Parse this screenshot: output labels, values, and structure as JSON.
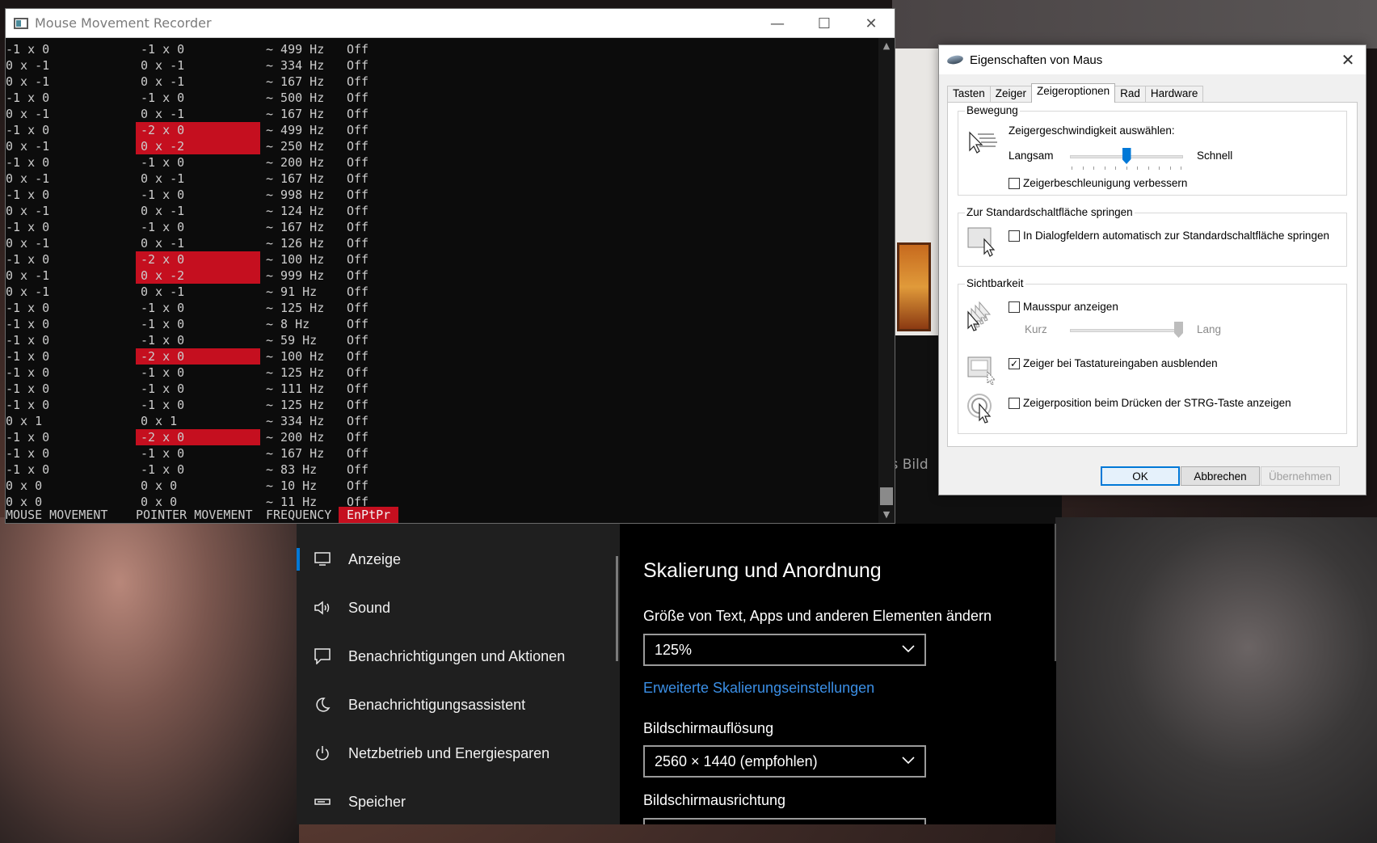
{
  "console": {
    "title": "Mouse Movement Recorder",
    "rows": [
      [
        "-1 x 0",
        "-1 x 0",
        "~ 499 Hz",
        "Off",
        false
      ],
      [
        "0 x -1",
        "0 x -1",
        "~ 334 Hz",
        "Off",
        false
      ],
      [
        "0 x -1",
        "0 x -1",
        "~ 167 Hz",
        "Off",
        false
      ],
      [
        "-1 x 0",
        "-1 x 0",
        "~ 500 Hz",
        "Off",
        false
      ],
      [
        "0 x -1",
        "0 x -1",
        "~ 167 Hz",
        "Off",
        false
      ],
      [
        "-1 x 0",
        "-2 x 0",
        "~ 499 Hz",
        "Off",
        true
      ],
      [
        "0 x -1",
        "0 x -2",
        "~ 250 Hz",
        "Off",
        true
      ],
      [
        "-1 x 0",
        "-1 x 0",
        "~ 200 Hz",
        "Off",
        false
      ],
      [
        "0 x -1",
        "0 x -1",
        "~ 167 Hz",
        "Off",
        false
      ],
      [
        "-1 x 0",
        "-1 x 0",
        "~ 998 Hz",
        "Off",
        false
      ],
      [
        "0 x -1",
        "0 x -1",
        "~ 124 Hz",
        "Off",
        false
      ],
      [
        "-1 x 0",
        "-1 x 0",
        "~ 167 Hz",
        "Off",
        false
      ],
      [
        "0 x -1",
        "0 x -1",
        "~ 126 Hz",
        "Off",
        false
      ],
      [
        "-1 x 0",
        "-2 x 0",
        "~ 100 Hz",
        "Off",
        true
      ],
      [
        "0 x -1",
        "0 x -2",
        "~ 999 Hz",
        "Off",
        true
      ],
      [
        "0 x -1",
        "0 x -1",
        "~ 91 Hz",
        "Off",
        false
      ],
      [
        "-1 x 0",
        "-1 x 0",
        "~ 125 Hz",
        "Off",
        false
      ],
      [
        "-1 x 0",
        "-1 x 0",
        "~ 8 Hz",
        "Off",
        false
      ],
      [
        "-1 x 0",
        "-1 x 0",
        "~ 59 Hz",
        "Off",
        false
      ],
      [
        "-1 x 0",
        "-2 x 0",
        "~ 100 Hz",
        "Off",
        true
      ],
      [
        "-1 x 0",
        "-1 x 0",
        "~ 125 Hz",
        "Off",
        false
      ],
      [
        "-1 x 0",
        "-1 x 0",
        "~ 111 Hz",
        "Off",
        false
      ],
      [
        "-1 x 0",
        "-1 x 0",
        "~ 125 Hz",
        "Off",
        false
      ],
      [
        "0 x 1",
        "0 x 1",
        "~ 334 Hz",
        "Off",
        false
      ],
      [
        "-1 x 0",
        "-2 x 0",
        "~ 200 Hz",
        "Off",
        true
      ],
      [
        "-1 x 0",
        "-1 x 0",
        "~ 167 Hz",
        "Off",
        false
      ],
      [
        "-1 x 0",
        "-1 x 0",
        "~ 83 Hz",
        "Off",
        false
      ],
      [
        "0 x 0",
        "0 x 0",
        "~ 10 Hz",
        "Off",
        false
      ],
      [
        "0 x 0",
        "0 x 0",
        "~ 11 Hz",
        "Off",
        false
      ]
    ],
    "footer": {
      "mouse": "MOUSE MOVEMENT",
      "pointer": "POINTER MOVEMENT",
      "frequency": "FREQUENCY",
      "enptpr": "EnPtPr"
    },
    "highlight_color": "#c50f1f"
  },
  "dialog": {
    "title": "Eigenschaften von Maus",
    "tabs": [
      "Tasten",
      "Zeiger",
      "Zeigeroptionen",
      "Rad",
      "Hardware"
    ],
    "active_tab": "Zeigeroptionen",
    "bewegung": {
      "label": "Bewegung",
      "speed_label": "Zeigergeschwindigkeit auswählen:",
      "slow": "Langsam",
      "fast": "Schnell",
      "speed_level": 0.5,
      "enhance_label": "Zeigerbeschleunigung verbessern",
      "enhance_checked": false
    },
    "snap": {
      "label": "Zur Standardschaltfläche springen",
      "checkbox_label": "In Dialogfeldern automatisch zur Standardschaltfläche springen",
      "checked": false
    },
    "visibility": {
      "label": "Sichtbarkeit",
      "trails_label": "Mausspur anzeigen",
      "trails_checked": false,
      "short": "Kurz",
      "long": "Lang",
      "trail_level": 1.0,
      "hide_label": "Zeiger bei Tastatureingaben ausblenden",
      "hide_checked": true,
      "ctrl_label": "Zeigerposition beim Drücken der STRG-Taste anzeigen",
      "ctrl_checked": false
    },
    "buttons": {
      "ok": "OK",
      "cancel": "Abbrechen",
      "apply": "Übernehmen"
    },
    "accent": "#0078d7"
  },
  "settings": {
    "nav": [
      {
        "label": "Anzeige",
        "icon": "monitor-icon",
        "active": true
      },
      {
        "label": "Sound",
        "icon": "speaker-icon",
        "active": false
      },
      {
        "label": "Benachrichtigungen und Aktionen",
        "icon": "notification-icon",
        "active": false
      },
      {
        "label": "Benachrichtigungsassistent",
        "icon": "moon-icon",
        "active": false
      },
      {
        "label": "Netzbetrieb und Energiesparen",
        "icon": "power-icon",
        "active": false
      },
      {
        "label": "Speicher",
        "icon": "storage-icon",
        "active": false
      }
    ],
    "heading": "Skalierung und Anordnung",
    "scale_label": "Größe von Text, Apps und anderen Elementen ändern",
    "scale_value": "125%",
    "advanced_link": "Erweiterte Skalierungseinstellungen",
    "resolution_label": "Bildschirmauflösung",
    "resolution_value": "2560 × 1440 (empfohlen)",
    "orientation_label": "Bildschirmausrichtung"
  },
  "background": {
    "partial_text": "es Bild"
  }
}
